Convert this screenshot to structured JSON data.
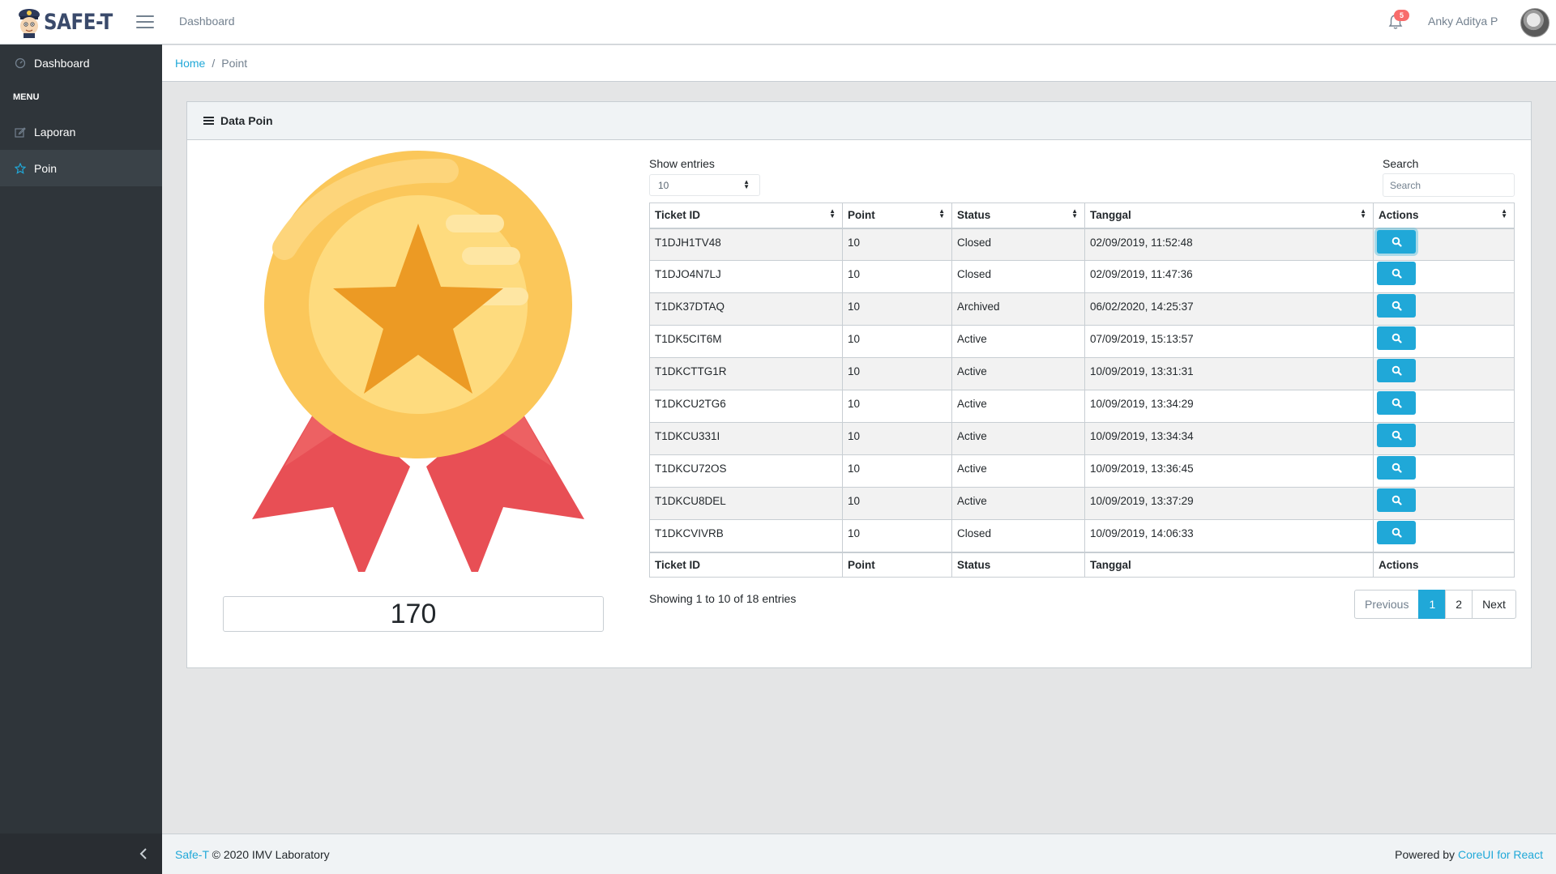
{
  "header": {
    "brand": "SAFE-T",
    "nav_dashboard": "Dashboard",
    "notification_count": "5",
    "user_name": "Anky Aditya P"
  },
  "sidebar": {
    "dashboard_label": "Dashboard",
    "menu_title": "MENU",
    "items": [
      {
        "label": "Laporan",
        "icon": "pencil-square-icon"
      },
      {
        "label": "Poin",
        "icon": "star-icon"
      }
    ]
  },
  "breadcrumb": {
    "home": "Home",
    "current": "Point"
  },
  "card": {
    "title": "Data Poin",
    "total_points": "170"
  },
  "table_controls": {
    "show_entries_label": "Show entries",
    "entries_value": "10",
    "search_label": "Search",
    "search_placeholder": "Search"
  },
  "table": {
    "columns": [
      "Ticket ID",
      "Point",
      "Status",
      "Tanggal",
      "Actions"
    ],
    "rows": [
      {
        "ticket_id": "T1DJH1TV48",
        "point": "10",
        "status": "Closed",
        "tanggal": "02/09/2019, 11:52:48"
      },
      {
        "ticket_id": "T1DJO4N7LJ",
        "point": "10",
        "status": "Closed",
        "tanggal": "02/09/2019, 11:47:36"
      },
      {
        "ticket_id": "T1DK37DTAQ",
        "point": "10",
        "status": "Archived",
        "tanggal": "06/02/2020, 14:25:37"
      },
      {
        "ticket_id": "T1DK5CIT6M",
        "point": "10",
        "status": "Active",
        "tanggal": "07/09/2019, 15:13:57"
      },
      {
        "ticket_id": "T1DKCTTG1R",
        "point": "10",
        "status": "Active",
        "tanggal": "10/09/2019, 13:31:31"
      },
      {
        "ticket_id": "T1DKCU2TG6",
        "point": "10",
        "status": "Active",
        "tanggal": "10/09/2019, 13:34:29"
      },
      {
        "ticket_id": "T1DKCU331I",
        "point": "10",
        "status": "Active",
        "tanggal": "10/09/2019, 13:34:34"
      },
      {
        "ticket_id": "T1DKCU72OS",
        "point": "10",
        "status": "Active",
        "tanggal": "10/09/2019, 13:36:45"
      },
      {
        "ticket_id": "T1DKCU8DEL",
        "point": "10",
        "status": "Active",
        "tanggal": "10/09/2019, 13:37:29"
      },
      {
        "ticket_id": "T1DKCVIVRB",
        "point": "10",
        "status": "Closed",
        "tanggal": "10/09/2019, 14:06:33"
      }
    ],
    "info": "Showing 1 to 10 of 18 entries"
  },
  "pagination": {
    "previous": "Previous",
    "pages": [
      "1",
      "2"
    ],
    "next": "Next"
  },
  "footer": {
    "brand_link": "Safe-T",
    "copyright": "© 2020 IMV Laboratory",
    "powered_by": "Powered by",
    "powered_link": "CoreUI for React"
  },
  "colors": {
    "primary": "#20a8d8",
    "sidebar": "#2f353a",
    "badge": "#f86c6b",
    "medal_gold": "#fbc75a",
    "medal_star": "#ec9a24",
    "ribbon": "#ea5a5a"
  }
}
